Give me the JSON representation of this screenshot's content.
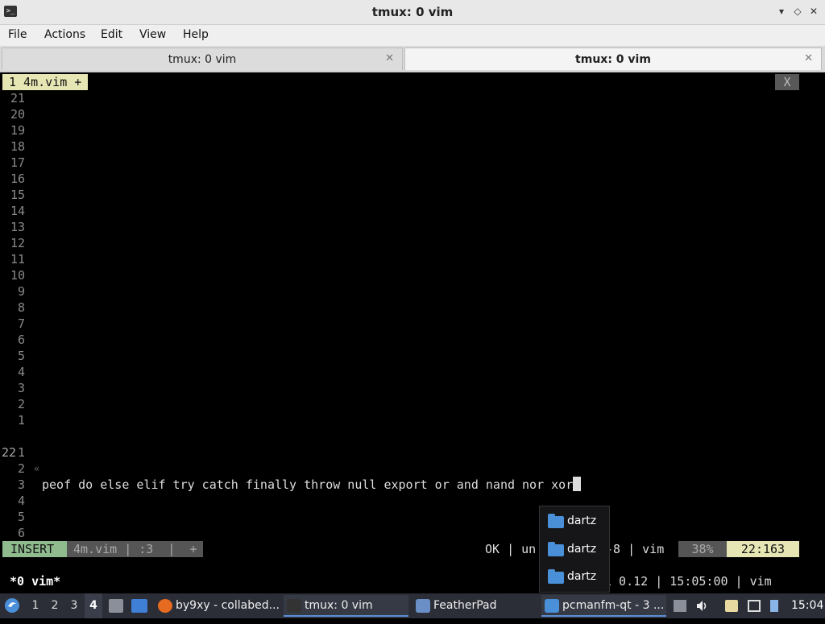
{
  "window": {
    "title": "tmux: 0 vim",
    "min": "▾",
    "max": "◇",
    "close": "✕"
  },
  "menu": [
    "File",
    "Actions",
    "Edit",
    "View",
    "Help"
  ],
  "tabs": [
    {
      "label": "tmux: 0 vim",
      "close": "✕"
    },
    {
      "label": "tmux: 0 vim",
      "close": "✕"
    }
  ],
  "vim": {
    "buffer_label": "1 4m.vim +",
    "buffer_close": "X",
    "relative_above": [
      "21",
      "20",
      "19",
      "18",
      "17",
      "16",
      "15",
      "14",
      "13",
      "12",
      "11",
      "10",
      "9",
      "8",
      "7",
      "6",
      "5",
      "4",
      "3",
      "2",
      "1"
    ],
    "current_line_number": "22",
    "current_line_marker": "«",
    "current_line_text": "peof do else elif try catch finally throw null export or and nand nor xor",
    "relative_below": [
      "1",
      "2",
      "3",
      "4",
      "5",
      "6"
    ],
    "status": {
      "mode": "INSERT",
      "file": "4m.vim | :3  |  +",
      "right": "OK | un",
      "right_tail": "-8 | vim",
      "percent": "38%",
      "position": "22:163"
    }
  },
  "tmux": {
    "window": "*0 vim*",
    "right": "1 0.12 | 15:05:00 | vim"
  },
  "popup": {
    "items": [
      "dartz",
      "dartz",
      "dartz"
    ]
  },
  "taskbar": {
    "workspaces": [
      "1",
      "2",
      "3",
      "4"
    ],
    "active_workspace": "4",
    "tasks": [
      {
        "label": "by9xy - collabed..."
      },
      {
        "label": "tmux: 0 vim"
      },
      {
        "label": "FeatherPad"
      },
      {
        "label": "pcmanfm-qt - 3 ..."
      }
    ],
    "clock": "15:04"
  }
}
